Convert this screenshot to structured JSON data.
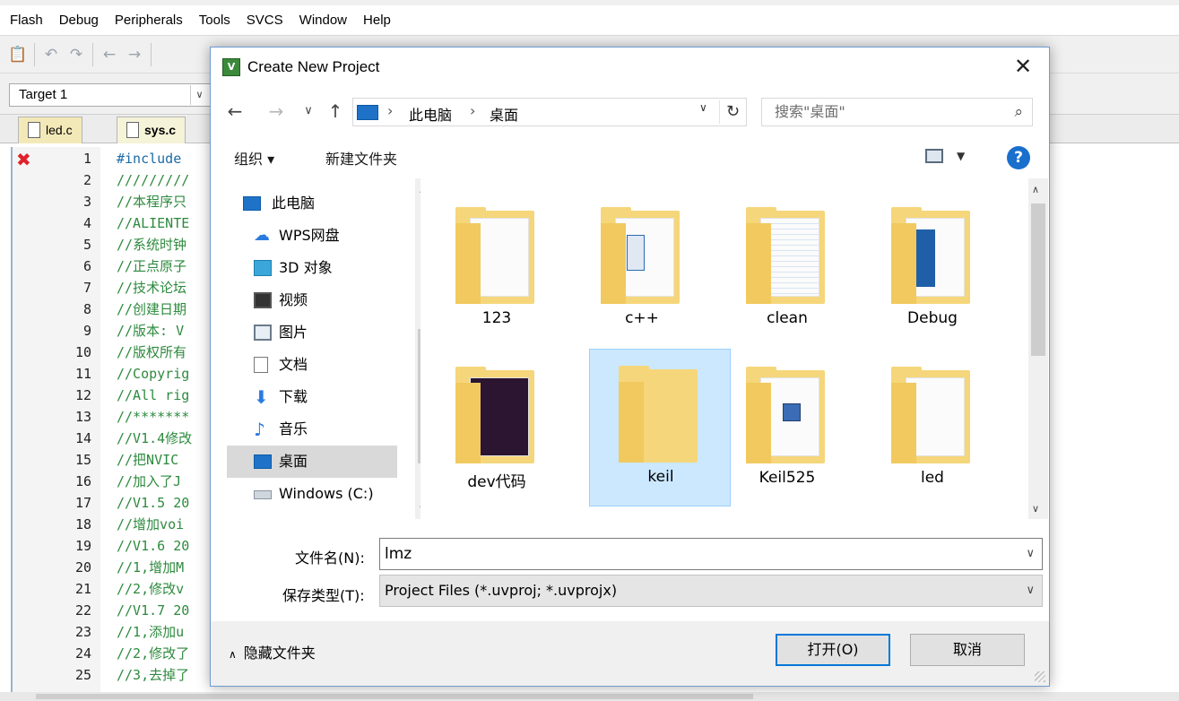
{
  "ide": {
    "menu": [
      "Flash",
      "Debug",
      "Peripherals",
      "Tools",
      "SVCS",
      "Window",
      "Help"
    ],
    "target": "Target 1",
    "tabs": [
      "led.c",
      "sys.c"
    ],
    "code_lines": [
      {
        "n": "1",
        "t": "#include"
      },
      {
        "n": "2",
        "t": "/////////"
      },
      {
        "n": "3",
        "t": "//本程序只"
      },
      {
        "n": "4",
        "t": "//ALIENTE"
      },
      {
        "n": "5",
        "t": "//系统时钟"
      },
      {
        "n": "6",
        "t": "//正点原子"
      },
      {
        "n": "7",
        "t": "//技术论坛"
      },
      {
        "n": "8",
        "t": "//创建日期"
      },
      {
        "n": "9",
        "t": "//版本: V"
      },
      {
        "n": "10",
        "t": "//版权所有"
      },
      {
        "n": "11",
        "t": "//Copyrig"
      },
      {
        "n": "12",
        "t": "//All rig"
      },
      {
        "n": "13",
        "t": "//*******"
      },
      {
        "n": "14",
        "t": "//V1.4修改"
      },
      {
        "n": "15",
        "t": "//把NVIC"
      },
      {
        "n": "16",
        "t": "//加入了J"
      },
      {
        "n": "17",
        "t": "//V1.5 20"
      },
      {
        "n": "18",
        "t": "//增加voi"
      },
      {
        "n": "19",
        "t": "//V1.6 20"
      },
      {
        "n": "20",
        "t": "//1,增加M"
      },
      {
        "n": "21",
        "t": "//2,修改v"
      },
      {
        "n": "22",
        "t": "//V1.7 20"
      },
      {
        "n": "23",
        "t": "//1,添加u"
      },
      {
        "n": "24",
        "t": "//2,修改了"
      },
      {
        "n": "25",
        "t": "//3,去掉了"
      }
    ]
  },
  "dialog": {
    "title": "Create New Project",
    "address": [
      "此电脑",
      "桌面"
    ],
    "search_placeholder": "搜索\"桌面\"",
    "organize": "组织 ▾",
    "new_folder": "新建文件夹",
    "nav_items": [
      {
        "label": "此电脑",
        "icon": "pc-icon"
      },
      {
        "label": "WPS网盘",
        "icon": "cloud-icon"
      },
      {
        "label": "3D 对象",
        "icon": "cube-icon"
      },
      {
        "label": "视频",
        "icon": "video-icon"
      },
      {
        "label": "图片",
        "icon": "picture-icon"
      },
      {
        "label": "文档",
        "icon": "document-icon"
      },
      {
        "label": "下载",
        "icon": "download-icon"
      },
      {
        "label": "音乐",
        "icon": "music-icon"
      },
      {
        "label": "桌面",
        "icon": "desktop-icon",
        "selected": true
      },
      {
        "label": "Windows (C:)",
        "icon": "drive-icon"
      }
    ],
    "folders": [
      {
        "name": "123"
      },
      {
        "name": "c++"
      },
      {
        "name": "clean"
      },
      {
        "name": "Debug"
      },
      {
        "name": "dev代码"
      },
      {
        "name": "keil",
        "selected": true
      },
      {
        "name": "Keil525"
      },
      {
        "name": "led"
      }
    ],
    "filename_label": "文件名(N):",
    "filename_value": "lmz",
    "filetype_label": "保存类型(T):",
    "filetype_value": "Project Files (*.uvproj; *.uvprojx)",
    "hide_folders": "隐藏文件夹",
    "save_button": "打开(O)",
    "cancel_button": "取消"
  }
}
